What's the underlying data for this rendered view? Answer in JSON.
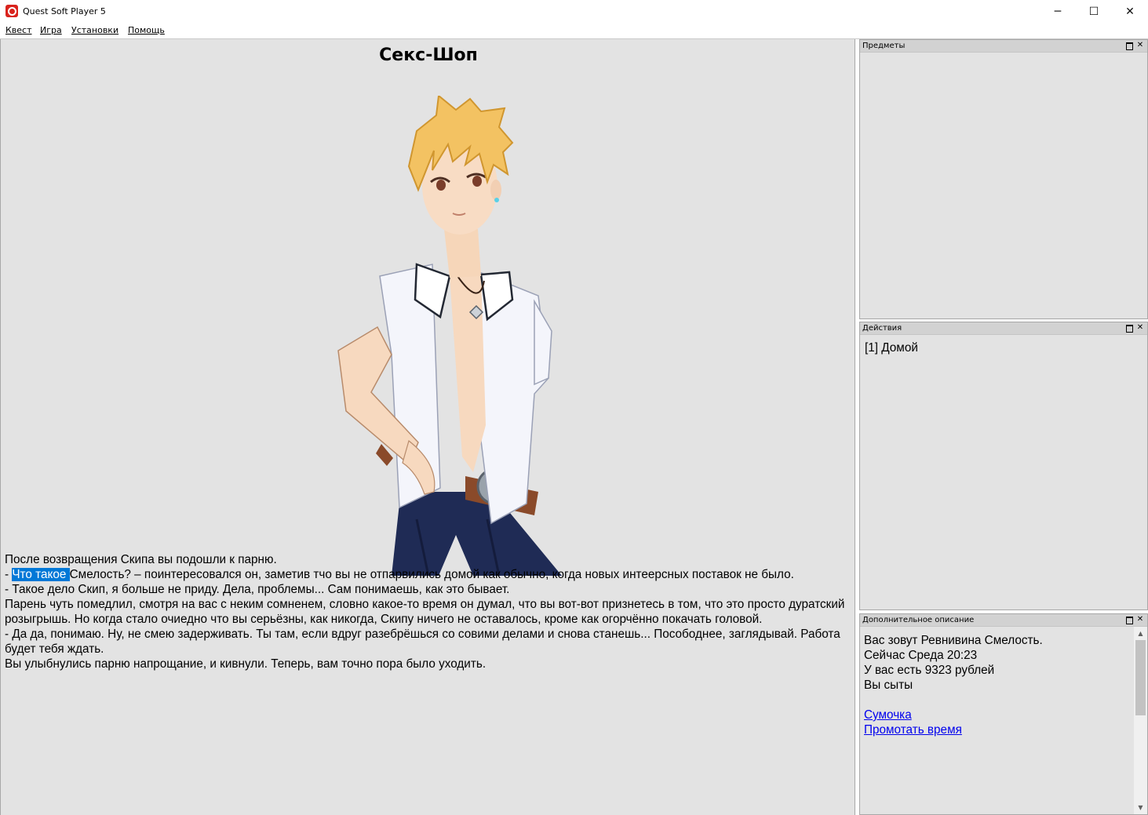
{
  "window": {
    "title": "Quest Soft Player 5"
  },
  "menu": [
    "Квест",
    "Игра",
    "Установки",
    "Помощь"
  ],
  "main": {
    "heading": "Секс-Шоп",
    "lines": [
      {
        "text": "После возвращения Скипа вы подошли к парню."
      },
      {
        "pre": "- ",
        "highlight": "Что такое ",
        "text": "Смелость? – поинтересовался он, заметив тчо вы не отпарвились домой как обычно, когда новых интеерсных поставок не было."
      },
      {
        "text": "- Такое дело Скип, я больше не приду. Дела, проблемы... Сам понимаешь, как это бывает."
      },
      {
        "text": "Парень чуть помедлил, смотря на вас с неким сомненем, словно какое-то время он думал, что вы вот-вот признетесь в том, что это просто дуратский розыгрышь. Но когда стало очиедно что вы серьёзны, как никогда, Скипу ничего не оставалось, кроме как огорчённо покачать головой."
      },
      {
        "text": "- Да да, понимаю. Ну, не смею задерживать. Ты там, если вдруг разебрёшься со совими делами и снова станешь... Посободнее, заглядывай. Работа будет тебя ждать."
      },
      {
        "text": "Вы улыбнулись парню напрощание, и кивнули. Теперь, вам точно пора было уходить."
      }
    ]
  },
  "panels": {
    "items": {
      "title": "Предметы"
    },
    "actions": {
      "title": "Действия",
      "items": [
        "[1] Домой"
      ]
    },
    "description": {
      "title": "Дополнительное описание",
      "lines": [
        "Вас зовут Ревнивина Смелость.",
        "Сейчас Среда 20:23",
        "У вас есть 9323 рублей",
        "Вы сыты"
      ],
      "links": [
        "Сумочка",
        "Промотать время"
      ]
    }
  },
  "colors": {
    "accent": "#0078d7",
    "link": "#0000ee",
    "panel_bg": "#e3e3e3"
  },
  "icons": [
    "app-icon",
    "minimize-icon",
    "maximize-icon",
    "close-icon",
    "restore-panel-icon",
    "close-panel-icon"
  ]
}
